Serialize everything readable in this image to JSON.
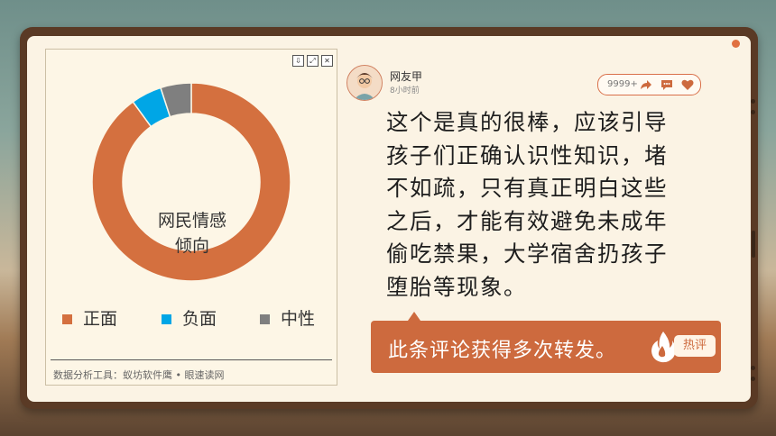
{
  "chart_panel": {
    "center_label_line1": "网民情感",
    "center_label_line2": "倾向",
    "footer": "数据分析工具：蚁坊软件鹰 • 眼速读网",
    "toolbar": {
      "download_icon": "download-icon",
      "expand_icon": "expand-icon",
      "close_icon": "close-icon"
    }
  },
  "chart_data": {
    "type": "pie",
    "categories": [
      "正面",
      "负面",
      "中性"
    ],
    "values": [
      90,
      5,
      5
    ],
    "colors": [
      "#d4703f",
      "#00a6e6",
      "#7f7f7f"
    ],
    "title": "网民情感倾向",
    "legend": "bottom"
  },
  "comment": {
    "user_name": "网友甲",
    "time": "8小时前",
    "count": "9999+",
    "text_lines": [
      "这个是真的很棒，应该引导",
      "孩子们正确认识性知识，堵",
      "不如疏，只有真正明白这些",
      "之后，才能有效避免未成年",
      "偷吃禁果，大学宿舍扔孩子",
      "堕胎等现象。"
    ],
    "icons": {
      "share": "share-icon",
      "comment": "comment-icon",
      "like": "heart-icon"
    }
  },
  "hot_note": {
    "text": "此条评论获得多次转发。",
    "tag": "热评"
  }
}
